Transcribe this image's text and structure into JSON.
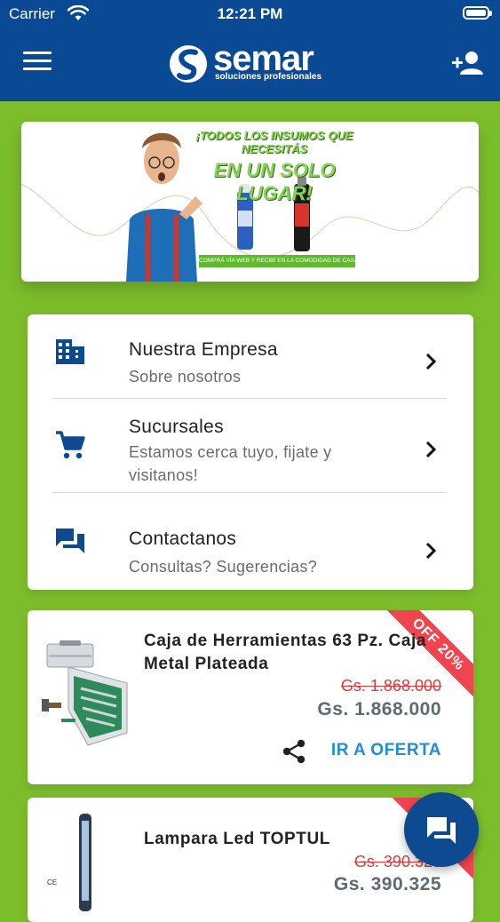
{
  "status_bar": {
    "carrier": "Carrier",
    "time": "12:21 PM"
  },
  "header": {
    "logo_word": "semar",
    "logo_tagline": "soluciones profesionales"
  },
  "banner": {
    "headline_line1": "¡TODOS LOS INSUMOS QUE NECESITÁS",
    "headline_line2": "EN UN SOLO LUGAR!",
    "strip": "COMPRÁ VÍA WEB Y RECIBÍ EN LA COMODIDAD DE CASA"
  },
  "menu": {
    "items": [
      {
        "title": "Nuestra Empresa",
        "subtitle": "Sobre nosotros",
        "icon": "building-icon"
      },
      {
        "title": "Sucursales",
        "subtitle": "Estamos cerca tuyo, fijate y visitanos!",
        "icon": "cart-icon"
      },
      {
        "title": "Contactanos",
        "subtitle": "Consultas? Sugerencias?",
        "icon": "chat-icon"
      }
    ]
  },
  "offers": [
    {
      "title": "Caja de Herramientas  63 Pz. Caja Metal Plateada",
      "old_price": "Gs. 1.868.000",
      "price": "Gs. 1.868.000",
      "badge": "OFF 20%",
      "action": "IR A OFERTA"
    },
    {
      "title": "Lampara Led TOPTUL",
      "old_price": "Gs. 390.325",
      "price": "Gs. 390.325"
    }
  ],
  "colors": {
    "primary": "#0a4a94",
    "background": "#7cbd2c",
    "accent": "#1e8fd6",
    "sale": "#f0444f"
  }
}
